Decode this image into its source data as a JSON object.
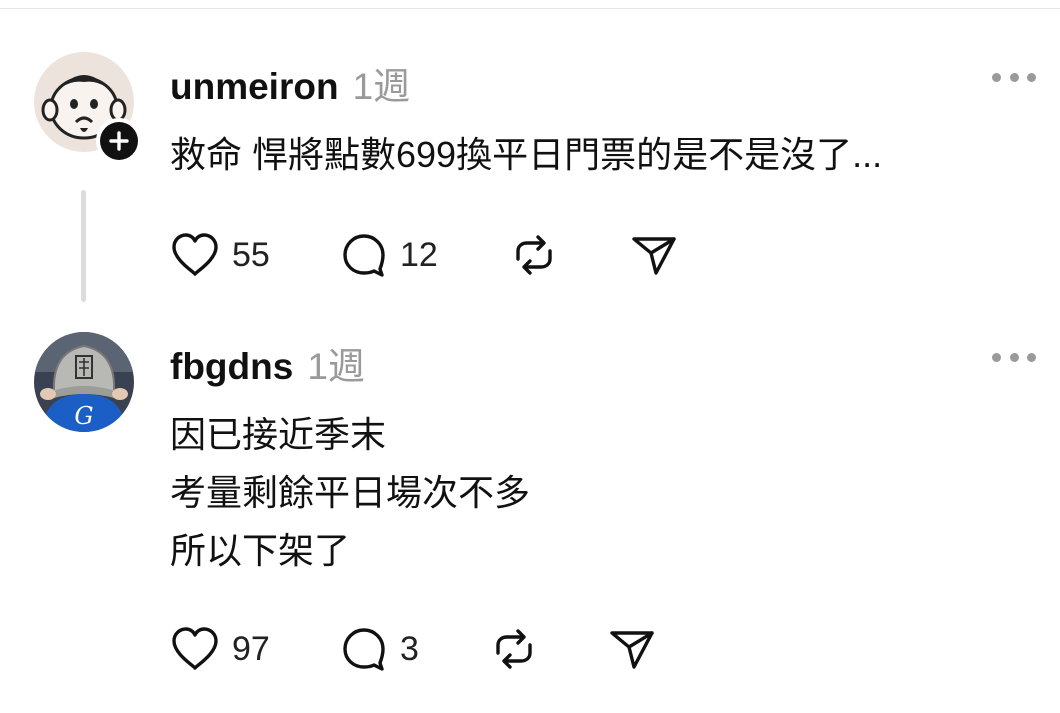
{
  "comments": [
    {
      "username": "unmeiron",
      "time": "1週",
      "text": "救命 悍將點數699換平日門票的是不是沒了...",
      "likes": "55",
      "replies": "12",
      "avatar_icon": "cartoon-monkey-avatar",
      "has_follow_badge": true
    },
    {
      "username": "fbgdns",
      "time": "1週",
      "lines": [
        "因已接近季末",
        "考量剩餘平日場次不多",
        "所以下架了"
      ],
      "likes": "97",
      "replies": "3",
      "avatar_icon": "baseball-cap-avatar"
    }
  ],
  "icons": {
    "like": "heart-icon",
    "reply": "comment-icon",
    "repost": "repost-icon",
    "share": "send-icon",
    "more": "more-horizontal-icon",
    "follow": "plus-icon"
  },
  "colors": {
    "text": "#111111",
    "muted": "#9a9a9a",
    "divider": "#e6e6e6"
  }
}
